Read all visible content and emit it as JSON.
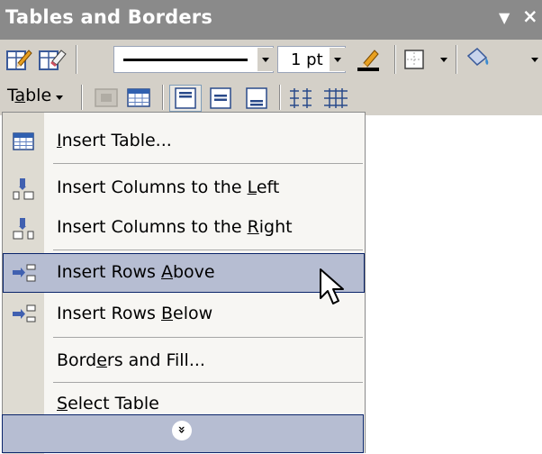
{
  "title_bar": {
    "title": "Tables and Borders",
    "options_glyph": "▼",
    "close_glyph": "×"
  },
  "toolbar_row1": {
    "line_weight": "1 pt",
    "icons": [
      "draw-table-icon",
      "eraser-icon",
      "line-style-dropdown",
      "line-weight-dropdown",
      "border-color-icon",
      "outside-border-icon",
      "shading-color-icon"
    ]
  },
  "toolbar_row2": {
    "table_menu": {
      "prefix": "T",
      "accel": "a",
      "suffix": "ble"
    },
    "icons": [
      "merge-cells-icon",
      "split-cells-icon",
      "align-top-icon",
      "align-center-icon",
      "align-bottom-icon",
      "distribute-rows-icon",
      "distribute-columns-icon"
    ]
  },
  "menu": {
    "items": [
      {
        "pre": "",
        "accel": "I",
        "post": "nsert Table...",
        "icon": "insert-table-icon"
      },
      {
        "pre": "Insert Columns to the ",
        "accel": "L",
        "post": "eft",
        "icon": "insert-columns-left-icon"
      },
      {
        "pre": "Insert Columns to the ",
        "accel": "R",
        "post": "ight",
        "icon": "insert-columns-right-icon"
      },
      {
        "pre": "Insert Rows ",
        "accel": "A",
        "post": "bove",
        "icon": "insert-rows-above-icon",
        "highlighted": true
      },
      {
        "pre": "Insert Rows ",
        "accel": "B",
        "post": "elow",
        "icon": "insert-rows-below-icon"
      },
      {
        "pre": "Bord",
        "accel": "e",
        "post": "rs and Fill...",
        "icon": ""
      },
      {
        "pre": "",
        "accel": "S",
        "post": "elect Table",
        "icon": ""
      }
    ],
    "expand_glyph": "»",
    "highlight_color": "#b6bdd2",
    "highlight_border": "#0a246a"
  },
  "colors": {
    "title_bar": "#8a8a8a",
    "toolbar": "#d4d0c8",
    "menu_background": "#f7f6f3",
    "menu_gutter": "#dedbd2"
  }
}
